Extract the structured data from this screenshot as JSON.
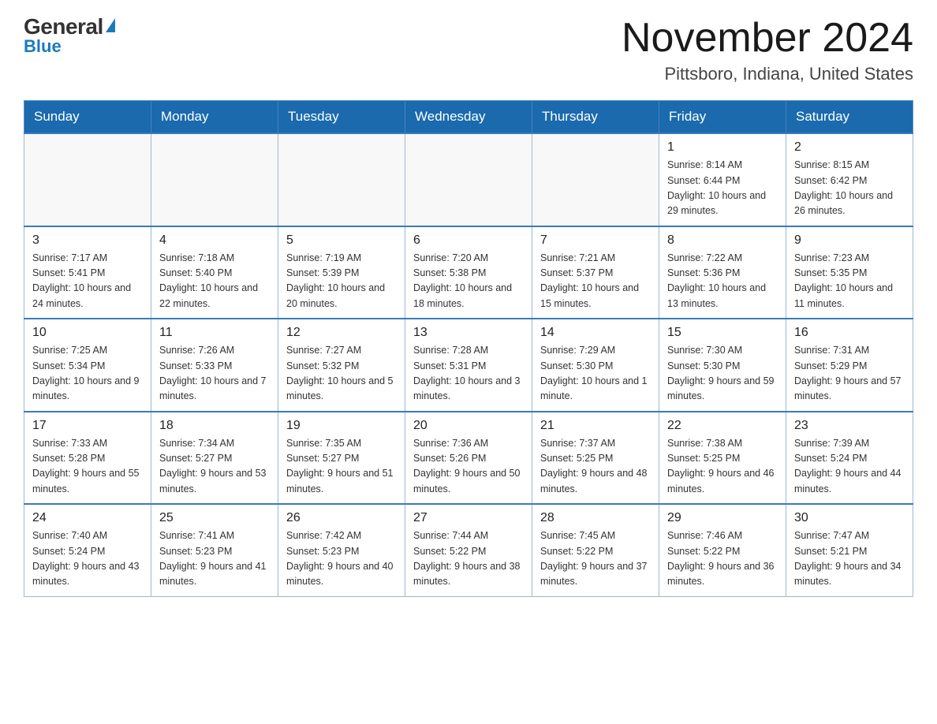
{
  "logo": {
    "general": "General",
    "blue": "Blue"
  },
  "title": "November 2024",
  "location": "Pittsboro, Indiana, United States",
  "days_of_week": [
    "Sunday",
    "Monday",
    "Tuesday",
    "Wednesday",
    "Thursday",
    "Friday",
    "Saturday"
  ],
  "weeks": [
    [
      {
        "day": "",
        "info": ""
      },
      {
        "day": "",
        "info": ""
      },
      {
        "day": "",
        "info": ""
      },
      {
        "day": "",
        "info": ""
      },
      {
        "day": "",
        "info": ""
      },
      {
        "day": "1",
        "info": "Sunrise: 8:14 AM\nSunset: 6:44 PM\nDaylight: 10 hours and 29 minutes."
      },
      {
        "day": "2",
        "info": "Sunrise: 8:15 AM\nSunset: 6:42 PM\nDaylight: 10 hours and 26 minutes."
      }
    ],
    [
      {
        "day": "3",
        "info": "Sunrise: 7:17 AM\nSunset: 5:41 PM\nDaylight: 10 hours and 24 minutes."
      },
      {
        "day": "4",
        "info": "Sunrise: 7:18 AM\nSunset: 5:40 PM\nDaylight: 10 hours and 22 minutes."
      },
      {
        "day": "5",
        "info": "Sunrise: 7:19 AM\nSunset: 5:39 PM\nDaylight: 10 hours and 20 minutes."
      },
      {
        "day": "6",
        "info": "Sunrise: 7:20 AM\nSunset: 5:38 PM\nDaylight: 10 hours and 18 minutes."
      },
      {
        "day": "7",
        "info": "Sunrise: 7:21 AM\nSunset: 5:37 PM\nDaylight: 10 hours and 15 minutes."
      },
      {
        "day": "8",
        "info": "Sunrise: 7:22 AM\nSunset: 5:36 PM\nDaylight: 10 hours and 13 minutes."
      },
      {
        "day": "9",
        "info": "Sunrise: 7:23 AM\nSunset: 5:35 PM\nDaylight: 10 hours and 11 minutes."
      }
    ],
    [
      {
        "day": "10",
        "info": "Sunrise: 7:25 AM\nSunset: 5:34 PM\nDaylight: 10 hours and 9 minutes."
      },
      {
        "day": "11",
        "info": "Sunrise: 7:26 AM\nSunset: 5:33 PM\nDaylight: 10 hours and 7 minutes."
      },
      {
        "day": "12",
        "info": "Sunrise: 7:27 AM\nSunset: 5:32 PM\nDaylight: 10 hours and 5 minutes."
      },
      {
        "day": "13",
        "info": "Sunrise: 7:28 AM\nSunset: 5:31 PM\nDaylight: 10 hours and 3 minutes."
      },
      {
        "day": "14",
        "info": "Sunrise: 7:29 AM\nSunset: 5:30 PM\nDaylight: 10 hours and 1 minute."
      },
      {
        "day": "15",
        "info": "Sunrise: 7:30 AM\nSunset: 5:30 PM\nDaylight: 9 hours and 59 minutes."
      },
      {
        "day": "16",
        "info": "Sunrise: 7:31 AM\nSunset: 5:29 PM\nDaylight: 9 hours and 57 minutes."
      }
    ],
    [
      {
        "day": "17",
        "info": "Sunrise: 7:33 AM\nSunset: 5:28 PM\nDaylight: 9 hours and 55 minutes."
      },
      {
        "day": "18",
        "info": "Sunrise: 7:34 AM\nSunset: 5:27 PM\nDaylight: 9 hours and 53 minutes."
      },
      {
        "day": "19",
        "info": "Sunrise: 7:35 AM\nSunset: 5:27 PM\nDaylight: 9 hours and 51 minutes."
      },
      {
        "day": "20",
        "info": "Sunrise: 7:36 AM\nSunset: 5:26 PM\nDaylight: 9 hours and 50 minutes."
      },
      {
        "day": "21",
        "info": "Sunrise: 7:37 AM\nSunset: 5:25 PM\nDaylight: 9 hours and 48 minutes."
      },
      {
        "day": "22",
        "info": "Sunrise: 7:38 AM\nSunset: 5:25 PM\nDaylight: 9 hours and 46 minutes."
      },
      {
        "day": "23",
        "info": "Sunrise: 7:39 AM\nSunset: 5:24 PM\nDaylight: 9 hours and 44 minutes."
      }
    ],
    [
      {
        "day": "24",
        "info": "Sunrise: 7:40 AM\nSunset: 5:24 PM\nDaylight: 9 hours and 43 minutes."
      },
      {
        "day": "25",
        "info": "Sunrise: 7:41 AM\nSunset: 5:23 PM\nDaylight: 9 hours and 41 minutes."
      },
      {
        "day": "26",
        "info": "Sunrise: 7:42 AM\nSunset: 5:23 PM\nDaylight: 9 hours and 40 minutes."
      },
      {
        "day": "27",
        "info": "Sunrise: 7:44 AM\nSunset: 5:22 PM\nDaylight: 9 hours and 38 minutes."
      },
      {
        "day": "28",
        "info": "Sunrise: 7:45 AM\nSunset: 5:22 PM\nDaylight: 9 hours and 37 minutes."
      },
      {
        "day": "29",
        "info": "Sunrise: 7:46 AM\nSunset: 5:22 PM\nDaylight: 9 hours and 36 minutes."
      },
      {
        "day": "30",
        "info": "Sunrise: 7:47 AM\nSunset: 5:21 PM\nDaylight: 9 hours and 34 minutes."
      }
    ]
  ]
}
